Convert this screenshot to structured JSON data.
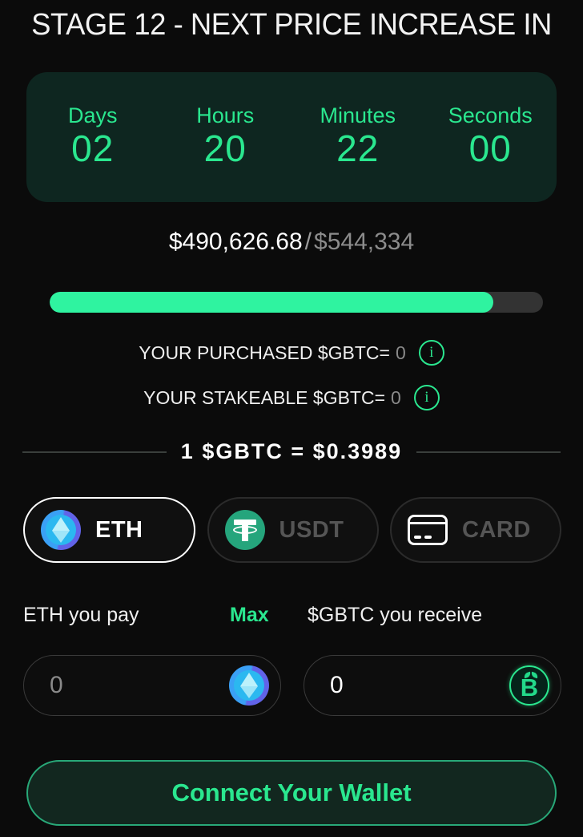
{
  "header": {
    "title": "STAGE 12 - NEXT PRICE INCREASE IN"
  },
  "countdown": {
    "units": [
      {
        "label": "Days",
        "value": "02"
      },
      {
        "label": "Hours",
        "value": "20"
      },
      {
        "label": "Minutes",
        "value": "22"
      },
      {
        "label": "Seconds",
        "value": "00"
      }
    ]
  },
  "raised": {
    "current": "$490,626.68",
    "separator": "/",
    "goal": "$544,334",
    "progress_percent": 90
  },
  "balances": [
    {
      "label": "YOUR PURCHASED $GBTC=",
      "value": "0",
      "info_icon": "info-icon",
      "info_glyph": "i"
    },
    {
      "label": "YOUR STAKEABLE $GBTC=",
      "value": "0",
      "info_icon": "info-icon",
      "info_glyph": "i"
    }
  ],
  "rate": {
    "text": "1 $GBTC = $0.3989"
  },
  "payment_tabs": [
    {
      "label": "ETH",
      "icon": "ethereum-coin-icon",
      "selected": true
    },
    {
      "label": "USDT",
      "icon": "tether-coin-icon",
      "selected": false
    },
    {
      "label": "CARD",
      "icon": "credit-card-icon",
      "selected": false
    }
  ],
  "swap": {
    "pay_label": "ETH you pay",
    "max_label": "Max",
    "receive_label": "$GBTC you receive",
    "pay_value": "",
    "pay_placeholder": "0",
    "receive_value": "0",
    "receive_placeholder": "0",
    "pay_icon": "ethereum-coin-icon",
    "receive_icon": "gbtc-coin-icon"
  },
  "actions": {
    "connect_label": "Connect Your Wallet"
  },
  "colors": {
    "background": "#0b0b0b",
    "accent_green": "#2ae78f",
    "progress_fill": "#2ff3a0",
    "progress_track": "#333333",
    "countdown_bg": "#0e2620",
    "muted_text": "#8a8a8a",
    "button_bg": "#12271f",
    "button_border": "#28a878"
  }
}
